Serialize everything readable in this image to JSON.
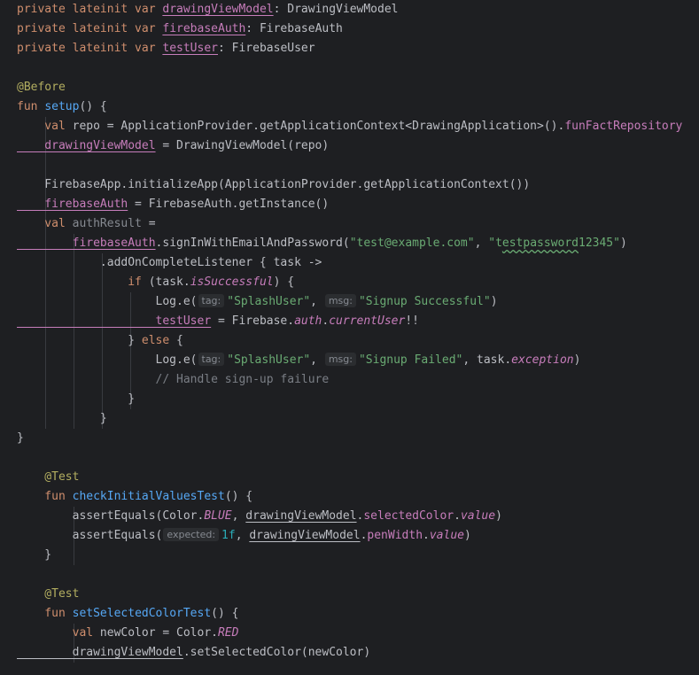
{
  "theme": {
    "background": "#1e1f22",
    "keyword": "#cf8e6d",
    "property": "#c77dbb",
    "function": "#56a8f5",
    "annotation": "#b3ae60",
    "string": "#6aab73",
    "comment": "#7a7e85",
    "number": "#2aacb8",
    "text": "#bcbec4"
  },
  "editor": {
    "lines": [
      [
        [
          "k",
          "private lateinit var "
        ],
        [
          "pu",
          "drawingViewModel"
        ],
        [
          "v",
          ": DrawingViewModel"
        ]
      ],
      [
        [
          "k",
          "private lateinit var "
        ],
        [
          "pu",
          "firebaseAuth"
        ],
        [
          "v",
          ": FirebaseAuth"
        ]
      ],
      [
        [
          "k",
          "private lateinit var "
        ],
        [
          "pu",
          "testUser"
        ],
        [
          "v",
          ": FirebaseUser"
        ]
      ],
      [],
      [
        [
          "ann",
          "@Before"
        ]
      ],
      [
        [
          "k",
          "fun "
        ],
        [
          "fn",
          "setup"
        ],
        [
          "v",
          "() {"
        ]
      ],
      [
        [
          "k",
          "    val "
        ],
        [
          "v",
          "repo = ApplicationProvider.getApplicationContext<DrawingApplication>()."
        ],
        [
          "p",
          "funFactRepository"
        ]
      ],
      [
        [
          "pu",
          "    drawingViewModel"
        ],
        [
          "v",
          " = DrawingViewModel(repo)"
        ]
      ],
      [],
      [
        [
          "v",
          "    FirebaseApp.initializeApp(ApplicationProvider.getApplicationContext())"
        ]
      ],
      [
        [
          "pu",
          "    firebaseAuth"
        ],
        [
          "v",
          " = FirebaseAuth.getInstance()"
        ]
      ],
      [
        [
          "k",
          "    val "
        ],
        [
          "m",
          "authResult"
        ],
        [
          "v",
          " ="
        ]
      ],
      [
        [
          "pu",
          "        firebaseAuth"
        ],
        [
          "v",
          ".signInWithEmailAndPassword("
        ],
        [
          "s",
          "\"test@example.com\""
        ],
        [
          "v",
          ", "
        ],
        [
          "s",
          "\"t"
        ],
        [
          "sw",
          "estpassword"
        ],
        [
          "s",
          "12345\""
        ],
        [
          "v",
          ")"
        ]
      ],
      [
        [
          "v",
          "            .addOnCompleteListener { task ->"
        ]
      ],
      [
        [
          "k",
          "                if "
        ],
        [
          "v",
          "(task."
        ],
        [
          "pi",
          "isSuccessful"
        ],
        [
          "v",
          ") {"
        ]
      ],
      [
        [
          "v",
          "                    Log.e("
        ],
        [
          "hint",
          "tag:"
        ],
        [
          "s",
          "\"SplashUser\""
        ],
        [
          "v",
          ", "
        ],
        [
          "hint",
          "msg:"
        ],
        [
          "s",
          "\"Signup Successful\""
        ],
        [
          "v",
          ")"
        ]
      ],
      [
        [
          "pu",
          "                    testUser"
        ],
        [
          "v",
          " = Firebase."
        ],
        [
          "pi",
          "auth"
        ],
        [
          "v",
          "."
        ],
        [
          "pi",
          "currentUser"
        ],
        [
          "v",
          "!!"
        ]
      ],
      [
        [
          "v",
          "                } "
        ],
        [
          "k",
          "else"
        ],
        [
          "v",
          " {"
        ]
      ],
      [
        [
          "v",
          "                    Log.e("
        ],
        [
          "hint",
          "tag:"
        ],
        [
          "s",
          "\"SplashUser\""
        ],
        [
          "v",
          ", "
        ],
        [
          "hint",
          "msg:"
        ],
        [
          "s",
          "\"Signup Failed\""
        ],
        [
          "v",
          ", task."
        ],
        [
          "pi",
          "exception"
        ],
        [
          "v",
          ")"
        ]
      ],
      [
        [
          "c",
          "                    // Handle sign-up failure"
        ]
      ],
      [
        [
          "v",
          "                }"
        ]
      ],
      [
        [
          "v",
          "            }"
        ]
      ],
      [
        [
          "v",
          "}"
        ]
      ],
      [],
      [
        [
          "ann",
          "    @Test"
        ]
      ],
      [
        [
          "k",
          "    fun "
        ],
        [
          "fn",
          "checkInitialValuesTest"
        ],
        [
          "v",
          "() {"
        ]
      ],
      [
        [
          "v",
          "        assertEquals(Color."
        ],
        [
          "pi",
          "BLUE"
        ],
        [
          "v",
          ", "
        ],
        [
          "vu",
          "drawingViewModel"
        ],
        [
          "v",
          "."
        ],
        [
          "p",
          "selectedColor"
        ],
        [
          "v",
          "."
        ],
        [
          "pi",
          "value"
        ],
        [
          "v",
          ")"
        ]
      ],
      [
        [
          "v",
          "        assertEquals("
        ],
        [
          "hint",
          "expected:"
        ],
        [
          "n",
          "1f"
        ],
        [
          "v",
          ", "
        ],
        [
          "vu",
          "drawingViewModel"
        ],
        [
          "v",
          "."
        ],
        [
          "p",
          "penWidth"
        ],
        [
          "v",
          "."
        ],
        [
          "pi",
          "value"
        ],
        [
          "v",
          ")"
        ]
      ],
      [
        [
          "v",
          "    }"
        ]
      ],
      [],
      [
        [
          "ann",
          "    @Test"
        ]
      ],
      [
        [
          "k",
          "    fun "
        ],
        [
          "fn",
          "setSelectedColorTest"
        ],
        [
          "v",
          "() {"
        ]
      ],
      [
        [
          "k",
          "        val "
        ],
        [
          "v",
          "newColor = Color."
        ],
        [
          "pi",
          "RED"
        ]
      ],
      [
        [
          "vu",
          "        drawingViewModel"
        ],
        [
          "v",
          ".setSelectedColor(newColor)"
        ]
      ]
    ]
  }
}
